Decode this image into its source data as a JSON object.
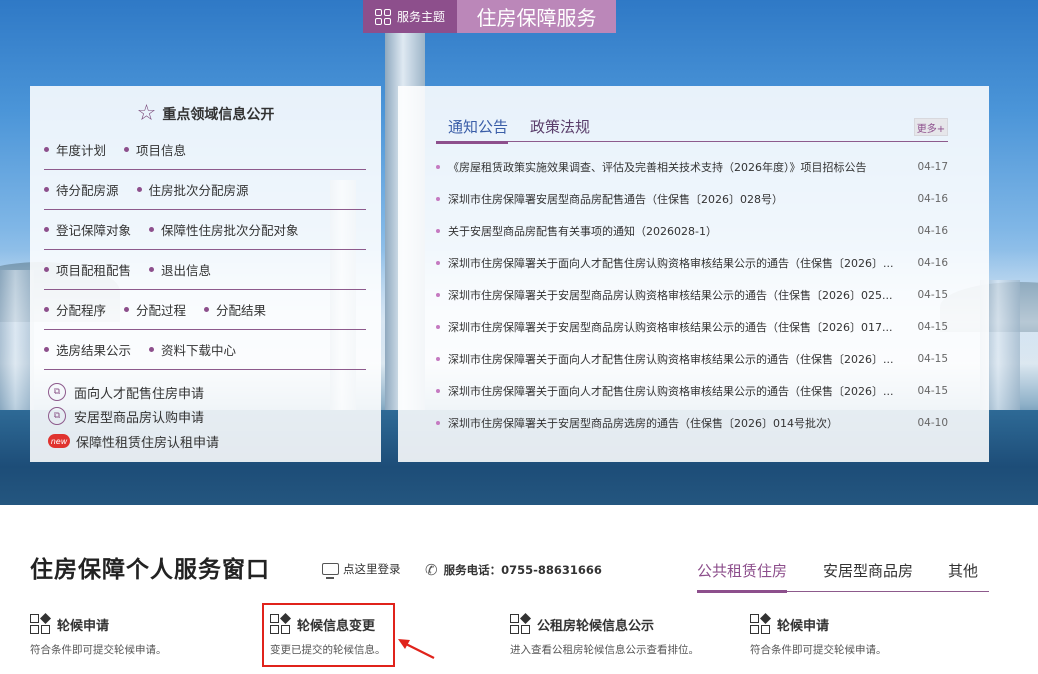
{
  "theme": {
    "tag": "服务主题",
    "title": "住房保障服务"
  },
  "left_panel": {
    "title": "重点领域信息公开",
    "rows": [
      [
        "年度计划",
        "项目信息"
      ],
      [
        "待分配房源",
        "住房批次分配房源"
      ],
      [
        "登记保障对象",
        "保障性住房批次分配对象"
      ],
      [
        "项目配租配售",
        "退出信息"
      ],
      [
        "分配程序",
        "分配过程",
        "分配结果"
      ],
      [
        "选房结果公示",
        "资料下载中心"
      ]
    ],
    "apps": [
      {
        "label": "面向人才配售住房申请",
        "icon": "apply-icon"
      },
      {
        "label": "安居型商品房认购申请",
        "icon": "apply-icon"
      },
      {
        "label": "保障性租赁住房认租申请",
        "icon": "new-badge-icon",
        "badge": "new"
      }
    ]
  },
  "news_panel": {
    "tabs": [
      "通知公告",
      "政策法规"
    ],
    "active_tab": 0,
    "more_label": "更多+",
    "items": [
      {
        "title": "《房屋租赁政策实施效果调查、评估及完善相关技术支持（2026年度）》项目招标公告",
        "date": "04-17"
      },
      {
        "title": "深圳市住房保障署安居型商品房配售通告（住保售〔2026〕028号）",
        "date": "04-16"
      },
      {
        "title": "关于安居型商品房配售有关事项的通知（2026028-1）",
        "date": "04-16"
      },
      {
        "title": "深圳市住房保障署关于面向人才配售住房认购资格审核结果公示的通告（住保售〔2026〕...",
        "date": "04-16"
      },
      {
        "title": "深圳市住房保障署关于安居型商品房认购资格审核结果公示的通告（住保售〔2026〕025...",
        "date": "04-15"
      },
      {
        "title": "深圳市住房保障署关于安居型商品房认购资格审核结果公示的通告（住保售〔2026〕017...",
        "date": "04-15"
      },
      {
        "title": "深圳市住房保障署关于面向人才配售住房认购资格审核结果公示的通告（住保售〔2026〕...",
        "date": "04-15"
      },
      {
        "title": "深圳市住房保障署关于面向人才配售住房认购资格审核结果公示的通告（住保售〔2026〕...",
        "date": "04-15"
      },
      {
        "title": "深圳市住房保障署关于安居型商品房选房的通告（住保售〔2026〕014号批次）",
        "date": "04-10"
      }
    ]
  },
  "service": {
    "title": "住房保障个人服务窗口",
    "login_label": "点这里登录",
    "phone_label": "服务电话：0755-88631666",
    "tabs": [
      "公共租赁住房",
      "安居型商品房",
      "其他"
    ],
    "active_tab": 0,
    "cards": [
      {
        "title": "轮候申请",
        "desc": "符合条件即可提交轮候申请。"
      },
      {
        "title": "轮候信息变更",
        "desc": "变更已提交的轮候信息。",
        "highlighted": true
      },
      {
        "title": "公租房轮候信息公示",
        "desc": "进入查看公租房轮候信息公示查看排位。"
      },
      {
        "title": "轮候申请",
        "desc": "符合条件即可提交轮候申请。"
      }
    ]
  },
  "colors": {
    "brand_purple": "#8d4f8c",
    "brand_purple_light": "#bb87b9",
    "highlight_red": "#e0231b"
  }
}
